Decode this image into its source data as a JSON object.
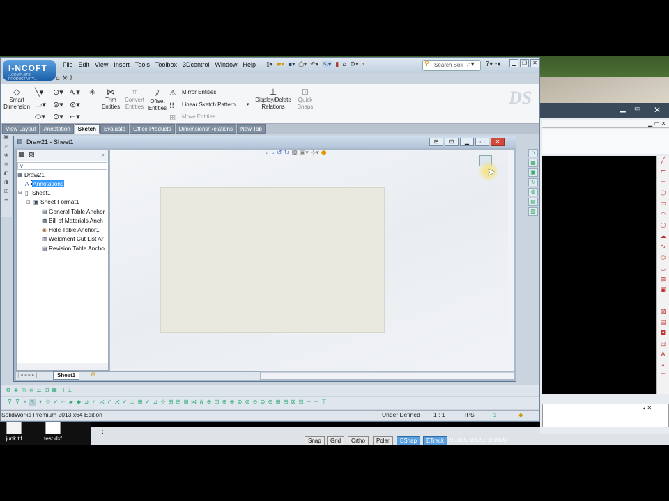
{
  "menu": [
    "File",
    "Edit",
    "View",
    "Insert",
    "Tools",
    "Toolbox",
    "3Dcontrol",
    "Window",
    "Help"
  ],
  "search": {
    "placeholder": "Search Soli"
  },
  "logo": {
    "text": "I-NCOFT",
    "subtitle": "...COMPLETE PRODUCTIVITY..."
  },
  "commands": {
    "smart_dimension": "Smart Dimension",
    "trim_entities": "Trim Entities",
    "convert_entities": "Convert Entities",
    "offset_entities": "Offset Entities",
    "mirror_entities": "Mirror Entities",
    "linear_sketch_pattern": "Linear Sketch Pattern",
    "move_entities": "Move Entities",
    "display_delete_relations": "Display/Delete Relations",
    "quick_snaps": "Quick Snaps"
  },
  "tabs": [
    "View Layout",
    "Annotation",
    "Sketch",
    "Evaluate",
    "Office Products",
    "Dimensions/Relations",
    "New Tab"
  ],
  "active_tab": "Sketch",
  "document": {
    "title": "Draw21 - Sheet1"
  },
  "tree": [
    {
      "label": "Draw21",
      "icon": "drawing-icon"
    },
    {
      "label": "Annotations",
      "icon": "annotations-icon",
      "selected": true
    },
    {
      "label": "Sheet1",
      "icon": "sheet-icon"
    },
    {
      "label": "Sheet Format1",
      "icon": "sheet-format-icon"
    },
    {
      "label": "General Table Anchor",
      "icon": "table-anchor-icon"
    },
    {
      "label": "Bill of Materials Anch",
      "icon": "bom-anchor-icon"
    },
    {
      "label": "Hole Table Anchor1",
      "icon": "hole-table-icon"
    },
    {
      "label": "Weldment Cut List Ar",
      "icon": "weldment-icon"
    },
    {
      "label": "Revision Table Ancho",
      "icon": "revision-table-icon"
    }
  ],
  "sheet_tab": "Sheet1",
  "status": {
    "edition": "SolidWorks Premium 2013 x64 Edition",
    "state": "Under Defined",
    "scale": "1 : 1",
    "units": "IPS"
  },
  "desktop": {
    "icons": [
      "junk.tif",
      "test.dxf"
    ]
  },
  "bg_app": {
    "toggles": [
      "Snap",
      "Grid",
      "Ortho",
      "Polar",
      "ESnap",
      "ETrack"
    ],
    "active_toggles": [
      "ESnap",
      "ETrack"
    ],
    "coords": "(9.1875,-0.5227,0.0000)",
    "prompt": ":"
  }
}
